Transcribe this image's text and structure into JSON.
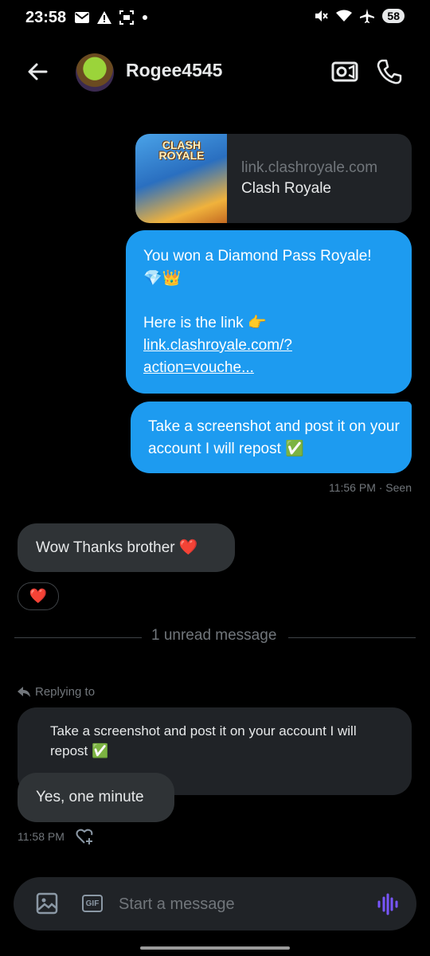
{
  "status_bar": {
    "time": "23:58",
    "battery": "58",
    "left_icons": [
      "mail-icon",
      "warning-icon",
      "screenshot-icon",
      "dot-icon"
    ],
    "right_icons": [
      "mute-icon",
      "wifi-icon",
      "airplane-icon"
    ]
  },
  "header": {
    "username": "Rogee4545",
    "icons": [
      "back-arrow-icon",
      "video-icon",
      "phone-icon"
    ]
  },
  "messages": {
    "link_card": {
      "logo_text": "CLASH ROYALE",
      "domain": "link.clashroyale.com",
      "title": "Clash Royale"
    },
    "outgoing_1": {
      "line1": "You won a Diamond Pass Royale!",
      "emoji1": "💎👑",
      "line2": "Here is the link 👉",
      "link_text": "link.clashroyale.com/?action=vouche..."
    },
    "outgoing_2": {
      "text": "Take a screenshot and post it on your account I will repost ✅"
    },
    "seen_status": "11:56 PM · Seen",
    "incoming_1": {
      "text": "Wow Thanks brother ❤️",
      "reaction": "❤️"
    },
    "unread_divider": "1 unread message",
    "reply": {
      "label": "Replying to",
      "quoted": "Take a screenshot and post it on your account I will repost ✅",
      "text": "Yes, one minute",
      "timestamp": "11:58 PM"
    }
  },
  "composer": {
    "placeholder": "Start a message",
    "gif_label": "GIF"
  },
  "colors": {
    "accent": "#1d9bf0",
    "incoming_bubble": "#2f3336",
    "background": "#000000",
    "voice_icon": "#7856ff"
  }
}
